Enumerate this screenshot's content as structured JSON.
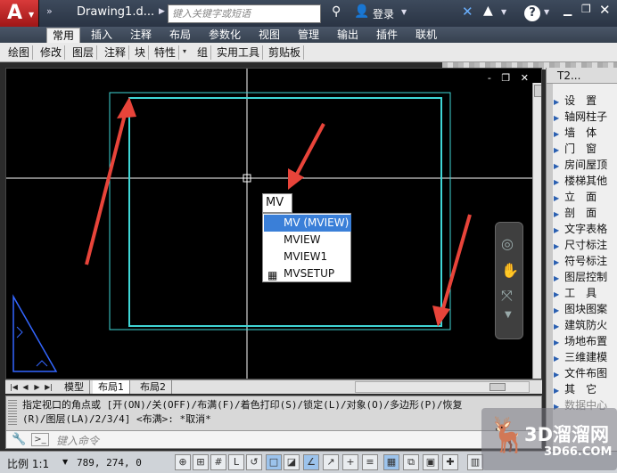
{
  "titlebar": {
    "document_title": "Drawing1.d...",
    "search_placeholder": "键入关键字或短语",
    "login_label": "登录"
  },
  "ribbon": {
    "tabs": [
      "常用",
      "插入",
      "注释",
      "布局",
      "参数化",
      "视图",
      "管理",
      "输出",
      "插件",
      "联机"
    ],
    "active_tab": "常用",
    "panels": [
      "绘图",
      "修改",
      "图层",
      "注释",
      "块",
      "特性",
      "组",
      "实用工具",
      "剪贴板"
    ]
  },
  "viewport": {
    "controls": [
      "-",
      "❐",
      "✕"
    ],
    "cad_lines": "#3fd6d6",
    "arrow_color": "#e8443a"
  },
  "autocomplete": {
    "typed": "MV",
    "items": [
      "MV (MVIEW)",
      "MVIEW",
      "MVIEW1",
      "MVSETUP"
    ],
    "selected_index": 0
  },
  "layout_tabs": {
    "tabs": [
      "模型",
      "布局1",
      "布局2"
    ],
    "active": "布局1"
  },
  "command": {
    "history": [
      "指定视口的角点或 [开(ON)/关(OFF)/布满(F)/着色打印(S)/锁定(L)/对象(O)/多边形(P)/恢复",
      "(R)/图层(LA)/2/3/4] <布满>: *取消*"
    ],
    "prefix": ">_",
    "placeholder": "键入命令"
  },
  "status": {
    "scale": "比例 1:1",
    "coords": "789, 274, 0"
  },
  "palette": {
    "title": "T2...",
    "items": [
      "设　置",
      "轴网柱子",
      "墙　体",
      "门　窗",
      "房间屋顶",
      "楼梯其他",
      "立　面",
      "剖　面",
      "文字表格",
      "尺寸标注",
      "符号标注",
      "图层控制",
      "工　具",
      "图块图案",
      "建筑防火",
      "场地布置",
      "三维建模",
      "文件布图",
      "其　它",
      "数据中心"
    ]
  },
  "watermark": {
    "title": "3D溜溜网",
    "domain": "3D66.COM"
  }
}
